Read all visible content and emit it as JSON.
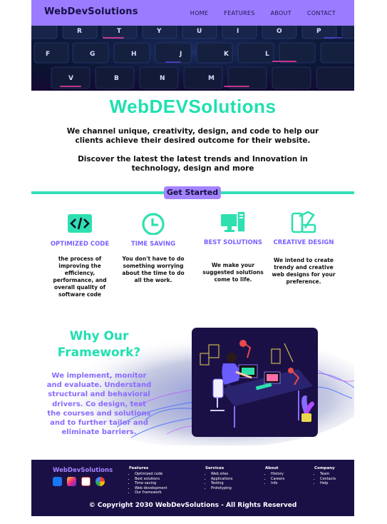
{
  "nav": {
    "brand": "WebDevSolutions",
    "links": [
      "HOME",
      "FEATURES",
      "ABOUT",
      "CONTACT"
    ]
  },
  "hero": {
    "keys_row1": [
      "R",
      "T",
      "Y",
      "U",
      "I",
      "O",
      "P"
    ],
    "keys_row2": [
      "F",
      "G",
      "H",
      "J",
      "K",
      "L"
    ],
    "keys_row3": [
      "V",
      "B",
      "N",
      "M"
    ]
  },
  "intro": {
    "title": "WebDEVSolutions",
    "line1": "We channel unique, creativity, design, and code to help our clients achieve their desired outcome for their website.",
    "line2": "Discover the latest  the latest trends and Innovation  in technology, design and more",
    "cta": "Get Started"
  },
  "features": [
    {
      "icon": "code-icon",
      "title": "OPTIMIZED CODE",
      "desc": "the process of improving the efficiency, performance, and overall quality of software code"
    },
    {
      "icon": "clock-icon",
      "title": "TIME SAVING",
      "desc": "You don't have to do something worrying about the time to do all the work."
    },
    {
      "icon": "computer-icon",
      "title": "BEST SOLUTIONS",
      "desc": "We make your suggested solutions come to life."
    },
    {
      "icon": "design-tools-icon",
      "title": "CREATIVE DESIGN",
      "desc": "We intend to create trendy and creative web designs for your preference."
    }
  ],
  "why": {
    "title": "Why Our Framework?",
    "text": "We implement, monitor and evaluate. Understand structural and behavioral drivers. Co design, test the courses and solutions and to further tailor and eliminate barriers."
  },
  "footer": {
    "brand": "WebDevSolutions",
    "columns": [
      {
        "heading": "Features",
        "items": [
          "Optimized code",
          "Best solutions",
          "Time saving",
          "Web development",
          "Our framework"
        ]
      },
      {
        "heading": "Services",
        "items": [
          "Web sites",
          "Applications",
          "Testing",
          "Prototyping"
        ]
      },
      {
        "heading": "About",
        "items": [
          "History",
          "Careers",
          "Info"
        ]
      },
      {
        "heading": "Company",
        "items": [
          "Team",
          "Contacts",
          "Help"
        ]
      }
    ],
    "copyright": "© Copyright 2030 WebDevSolutions - All Rights Reserved"
  },
  "colors": {
    "accent_purple": "#9b7bff",
    "accent_teal": "#1fe0b0",
    "footer_bg": "#1b1046"
  }
}
